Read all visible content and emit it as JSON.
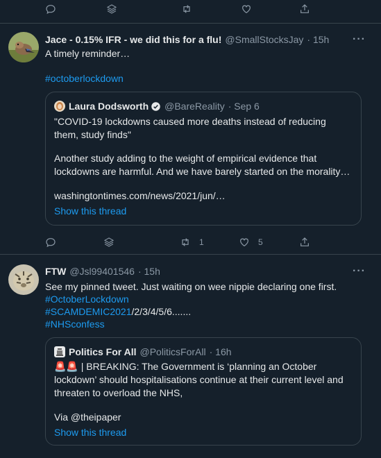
{
  "colors": {
    "background": "#15202b",
    "accent": "#1d9bf0",
    "muted": "#8b98a5",
    "text": "#e7e9ea",
    "border": "#38444d"
  },
  "top_actions": {
    "icons": [
      "reply-icon",
      "stack-icon",
      "retweet-icon",
      "like-icon",
      "share-icon"
    ]
  },
  "tweets": [
    {
      "author": "Jace - 0.15% IFR - we did this for a flu!",
      "handle": "@SmallStocksJay",
      "time": "· 15h",
      "more": "···",
      "text_line1": "A timely reminder…",
      "hashtag": "#octoberlockdown",
      "quote": {
        "author": "Laura Dodsworth",
        "handle": "@BareReality",
        "time": "· Sep 6",
        "p1": "\"COVID-19 lockdowns caused more deaths instead of reducing them, study finds\"",
        "p2": "Another study adding to the weight of empirical evidence that lockdowns are harmful. And we have barely started on the morality…",
        "p3": "washingtontimes.com/news/2021/jun/…",
        "thread": "Show this thread"
      },
      "actions": {
        "retweets": "1",
        "likes": "5"
      }
    },
    {
      "author": "FTW",
      "handle": "@Jsl99401546",
      "time": "· 15h",
      "more": "···",
      "line1": "See my pinned tweet. Just waiting on wee nippie declaring one first.",
      "line2": "#OctoberLockdown",
      "line3_tag": "#SCAMDEMIC2021",
      "line3_rest": "/2/3/4/5/6.......",
      "line4": "#NHSconfess",
      "quote": {
        "author": "Politics For All",
        "handle": "@PoliticsForAll",
        "time": "· 16h",
        "sirens": "🚨🚨",
        "p1": " | BREAKING: The Government is ‘planning an October lockdown’ should hospitalisations continue at their current level and threaten to overload the NHS,",
        "p2": "Via @theipaper",
        "thread": "Show this thread"
      }
    }
  ]
}
